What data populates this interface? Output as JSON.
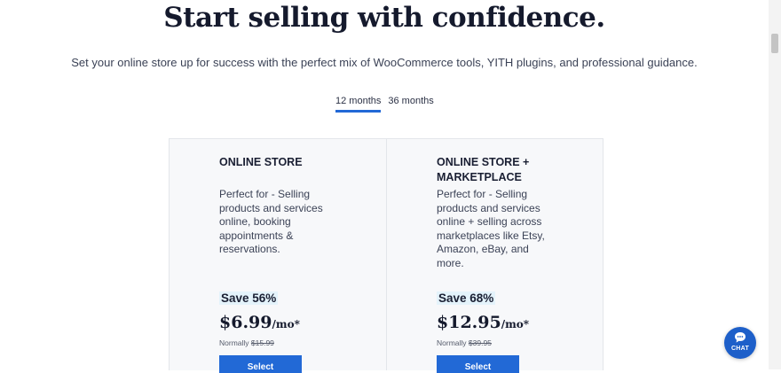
{
  "hero": {
    "title": "Start selling with confidence.",
    "subtitle": "Set your online store up for success with the perfect mix of WooCommerce tools, YITH plugins, and professional guidance."
  },
  "billing_tabs": [
    {
      "label": "12 months",
      "active": true
    },
    {
      "label": "36 months",
      "active": false
    }
  ],
  "plans": [
    {
      "title_lines": [
        "ONLINE STORE"
      ],
      "description_lines": [
        "Perfect for - Selling",
        "products and services",
        "online, booking",
        "appointments &",
        "reservations."
      ],
      "savings": "Save 56%",
      "price": "$6.99",
      "period": "/mo*",
      "normally_label": "Normally",
      "normal_price": "$15.99",
      "button": "Select"
    },
    {
      "title_lines": [
        "ONLINE STORE +",
        "MARKETPLACE"
      ],
      "description_lines": [
        "Perfect for - Selling",
        "products and services",
        "online + selling across",
        "marketplaces like Etsy,",
        "Amazon, eBay, and",
        "more."
      ],
      "savings": "Save 68%",
      "price": "$12.95",
      "period": "/mo*",
      "normally_label": "Normally",
      "normal_price": "$39.95",
      "button": "Select"
    }
  ],
  "chat_widget": {
    "label": "CHAT",
    "icon": "chat-bubble-icon"
  },
  "colors": {
    "accent": "#2269d6",
    "badge_bg": "#e4f3fb",
    "heading": "#151a2d",
    "card_bg": "#f7f8fa"
  }
}
